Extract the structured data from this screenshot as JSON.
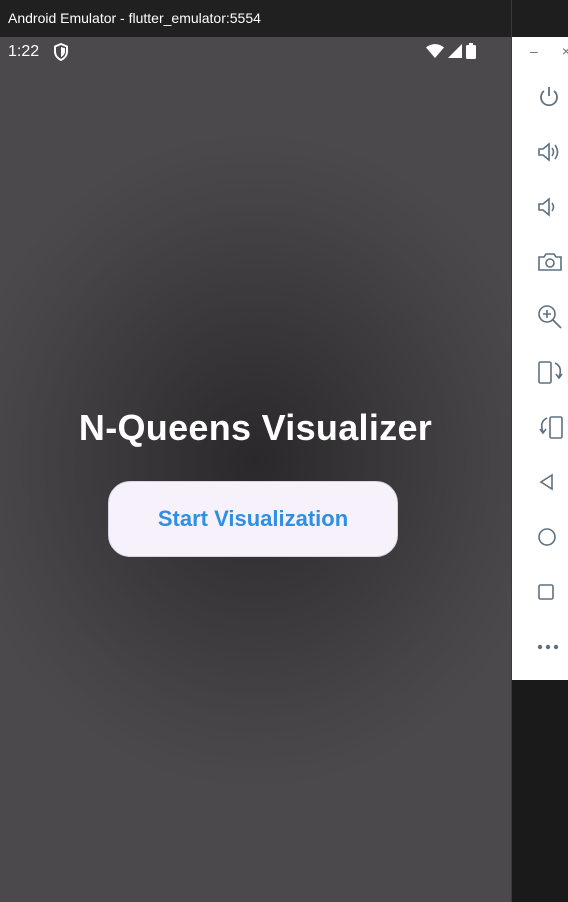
{
  "window": {
    "title": "Android Emulator - flutter_emulator:5554"
  },
  "status_bar": {
    "time": "1:22",
    "icons": [
      "shield-icon",
      "wifi-icon",
      "cellular-signal-icon",
      "battery-icon"
    ]
  },
  "app": {
    "title": "N-Queens Visualizer",
    "start_button_label": "Start Visualization",
    "accent_color": "#2f8fe0",
    "button_background": "#f6f1fa"
  },
  "toolbar": {
    "minimize_label": "–",
    "close_label": "×",
    "items": [
      {
        "name": "power-icon"
      },
      {
        "name": "volume-up-icon"
      },
      {
        "name": "volume-down-icon"
      },
      {
        "name": "camera-icon"
      },
      {
        "name": "zoom-icon"
      },
      {
        "name": "rotate-left-icon"
      },
      {
        "name": "rotate-right-icon"
      },
      {
        "name": "back-icon"
      },
      {
        "name": "home-icon"
      },
      {
        "name": "overview-icon"
      },
      {
        "name": "more-icon"
      }
    ]
  }
}
